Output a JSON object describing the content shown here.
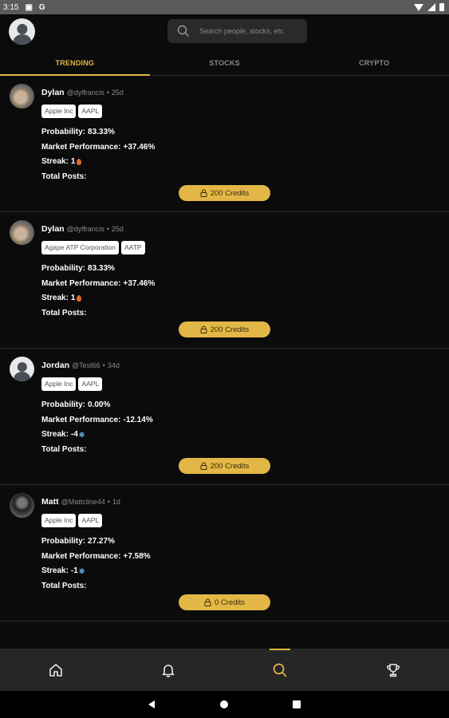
{
  "status_bar": {
    "time": "3:15",
    "icons": [
      "debug-icon",
      "google-icon",
      "wifi-icon",
      "signal-icon",
      "battery-icon"
    ]
  },
  "search": {
    "placeholder": "Search people, stocks, etc"
  },
  "tabs": [
    {
      "label": "TRENDING",
      "active": true
    },
    {
      "label": "STOCKS",
      "active": false
    },
    {
      "label": "CRYPTO",
      "active": false
    }
  ],
  "labels": {
    "probability": "Probability:",
    "market_performance": "Market Performance:",
    "streak": "Streak:",
    "total_posts": "Total Posts:"
  },
  "posts": [
    {
      "name": "Dylan",
      "handle": "@dylfrancis",
      "age": "25d",
      "chips": [
        "Apple Inc",
        "AAPL"
      ],
      "probability": "83.33%",
      "market_performance": "+37.46%",
      "streak": "1",
      "streak_icon": "fire-icon",
      "total_posts": "",
      "credits": "200 Credits",
      "avatar": "cat"
    },
    {
      "name": "Dylan",
      "handle": "@dylfrancis",
      "age": "25d",
      "chips": [
        "Agape ATP Corporation",
        "AATP"
      ],
      "probability": "83.33%",
      "market_performance": "+37.46%",
      "streak": "1",
      "streak_icon": "fire-icon",
      "total_posts": "",
      "credits": "200 Credits",
      "avatar": "cat"
    },
    {
      "name": "Jordan",
      "handle": "@Test66",
      "age": "34d",
      "chips": [
        "Apple Inc",
        "AAPL"
      ],
      "probability": "0.00%",
      "market_performance": "-12.14%",
      "streak": "-4",
      "streak_icon": "snowflake-icon",
      "total_posts": "",
      "credits": "200 Credits",
      "avatar": "default"
    },
    {
      "name": "Matt",
      "handle": "@Mattcline44",
      "age": "1d",
      "chips": [
        "Apple Inc",
        "AAPL"
      ],
      "probability": "27.27%",
      "market_performance": "+7.58%",
      "streak": "-1",
      "streak_icon": "snowflake-icon",
      "total_posts": "",
      "credits": "0 Credits",
      "avatar": "photo"
    }
  ],
  "bottom_nav": [
    {
      "icon": "home-icon",
      "active": false
    },
    {
      "icon": "bell-icon",
      "active": false
    },
    {
      "icon": "search-icon",
      "active": true
    },
    {
      "icon": "trophy-icon",
      "active": false
    }
  ],
  "colors": {
    "accent": "#e3b745",
    "background": "#0b0b0b",
    "nav_bg": "#262626"
  }
}
